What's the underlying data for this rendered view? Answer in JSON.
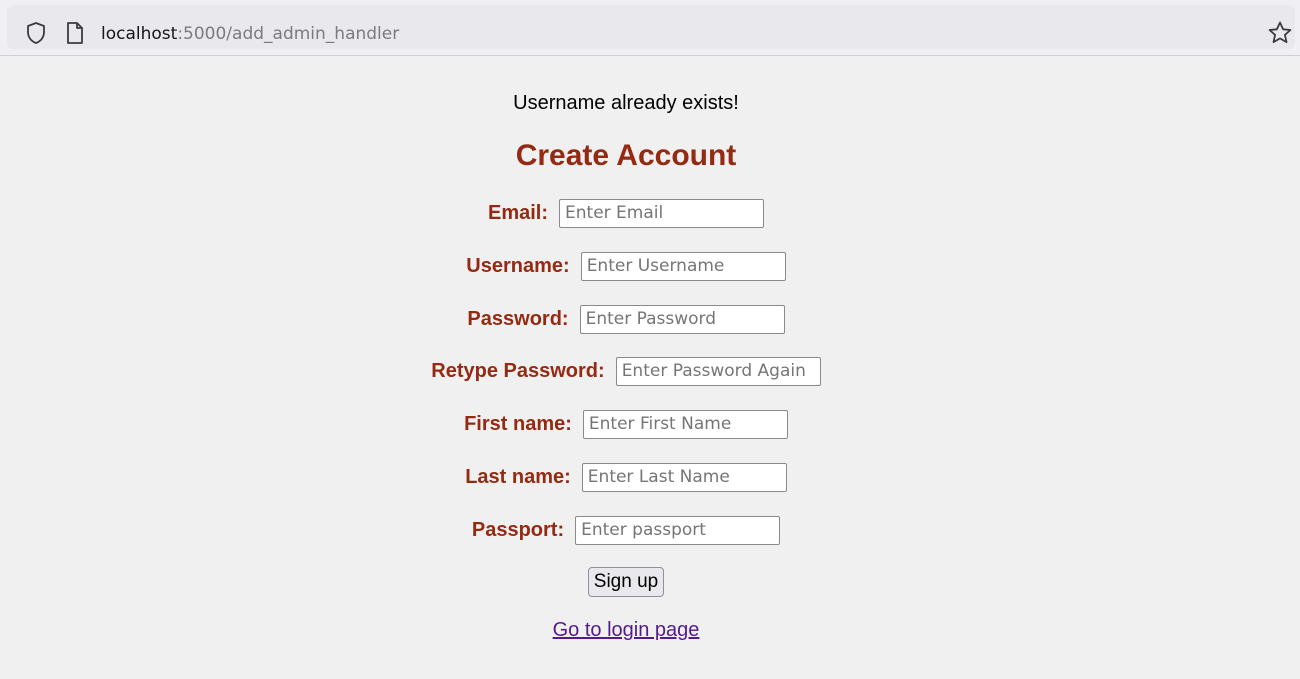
{
  "browser": {
    "url_host": "localhost",
    "url_path": ":5000/add_admin_handler"
  },
  "page": {
    "message": "Username already exists!",
    "title": "Create Account",
    "fields": [
      {
        "label": "Email:",
        "placeholder": "Enter Email",
        "value": ""
      },
      {
        "label": "Username:",
        "placeholder": "Enter Username",
        "value": ""
      },
      {
        "label": "Password:",
        "placeholder": "Enter Password",
        "value": ""
      },
      {
        "label": "Retype Password:",
        "placeholder": "Enter Password Again",
        "value": ""
      },
      {
        "label": "First name:",
        "placeholder": "Enter First Name",
        "value": ""
      },
      {
        "label": "Last name:",
        "placeholder": "Enter Last Name",
        "value": ""
      },
      {
        "label": "Passport:",
        "placeholder": "Enter passport",
        "value": ""
      }
    ],
    "submit_label": "Sign up",
    "login_link": "Go to login page"
  },
  "colors": {
    "label": "#952a12",
    "link": "#551a8b",
    "background": "#f0f0f0"
  },
  "icons": [
    "shield-icon",
    "page-icon",
    "star-icon"
  ]
}
